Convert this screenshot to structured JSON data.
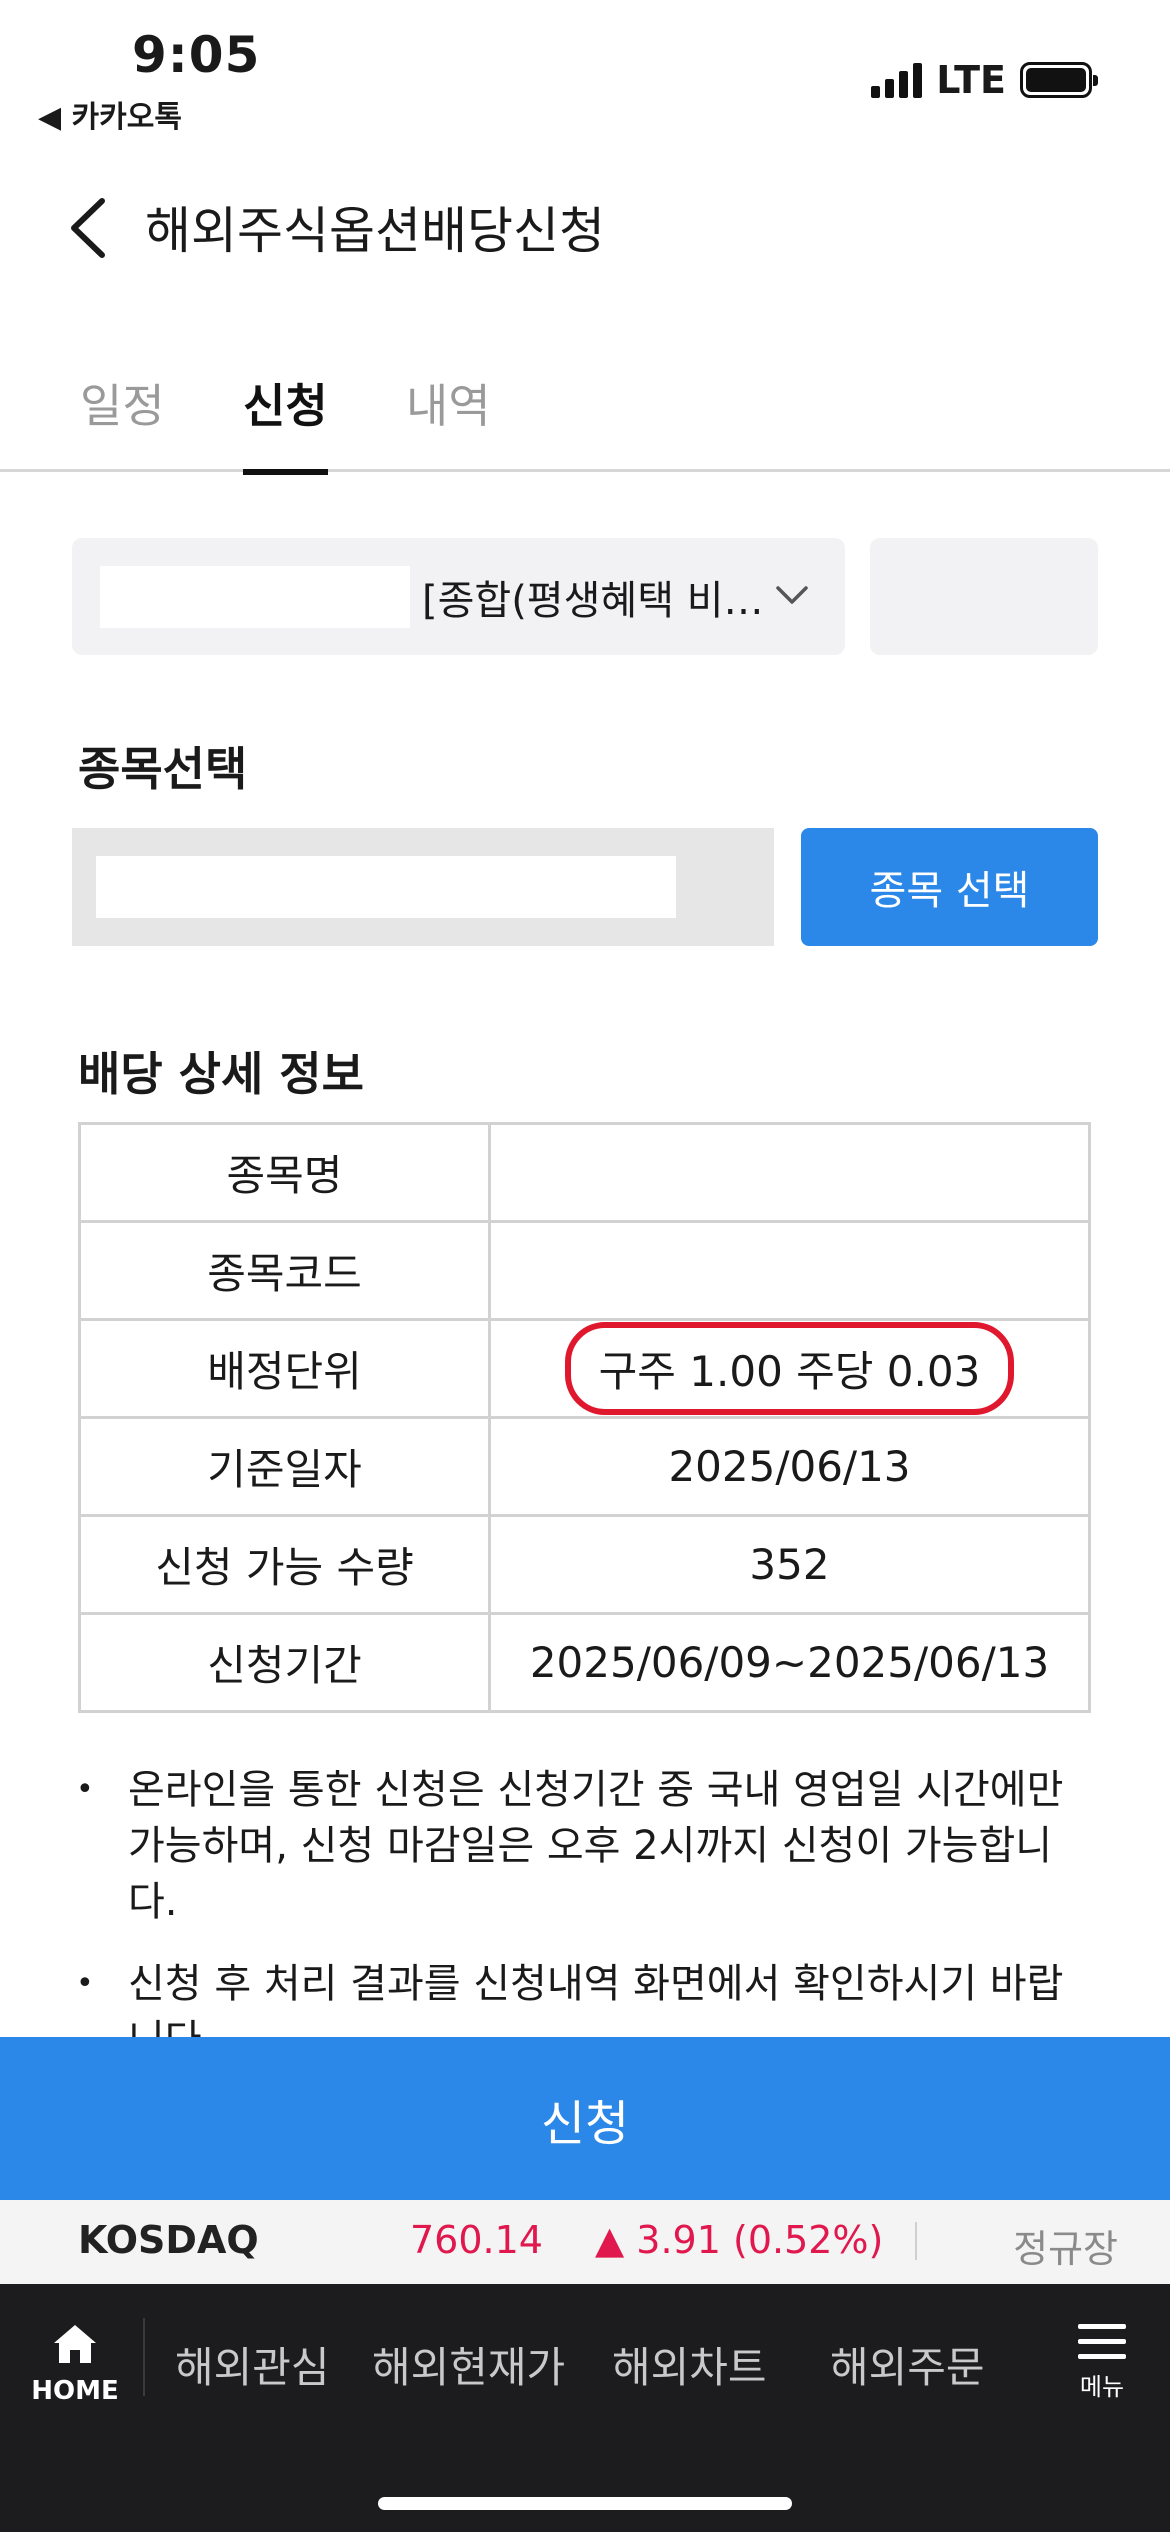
{
  "status_bar": {
    "time": "9:05",
    "back_app": "◀ 카카오톡",
    "network": "LTE"
  },
  "header": {
    "title": "해외주식옵션배당신청"
  },
  "tabs": [
    {
      "label": "일정",
      "active": false
    },
    {
      "label": "신청",
      "active": true
    },
    {
      "label": "내역",
      "active": false
    }
  ],
  "account": {
    "selected_text": "[종합(평생혜택 비…"
  },
  "stock_select": {
    "section_title": "종목선택",
    "button_label": "종목 선택"
  },
  "detail": {
    "section_title": "배당 상세 정보",
    "rows": [
      {
        "label": "종목명",
        "value": ""
      },
      {
        "label": "종목코드",
        "value": ""
      },
      {
        "label": "배정단위",
        "value": "구주 1.00 주당 0.03"
      },
      {
        "label": "기준일자",
        "value": "2025/06/13"
      },
      {
        "label": "신청 가능 수량",
        "value": "352"
      },
      {
        "label": "신청기간",
        "value": "2025/06/09~2025/06/13"
      }
    ]
  },
  "notes": [
    "온라인을 통한 신청은 신청기간 중 국내 영업일 시간에만 가능하며, 신청 마감일은 오후 2시까지 신청이 가능합니다.",
    "신청 후 처리 결과를 신청내역 화면에서 확인하시기 바랍니다."
  ],
  "submit": {
    "label": "신청"
  },
  "ticker": {
    "name": "KOSDAQ",
    "price": "760.14",
    "change": "▲ 3.91 (0.52%)",
    "status": "정규장"
  },
  "bottom_nav": {
    "home_label": "HOME",
    "items": [
      "해외관심",
      "해외현재가",
      "해외차트",
      "해외주문"
    ],
    "menu_label": "메뉴"
  },
  "colors": {
    "accent": "#2b87e8",
    "highlight_ring": "#e0182d",
    "ticker_up": "#e0184d"
  }
}
